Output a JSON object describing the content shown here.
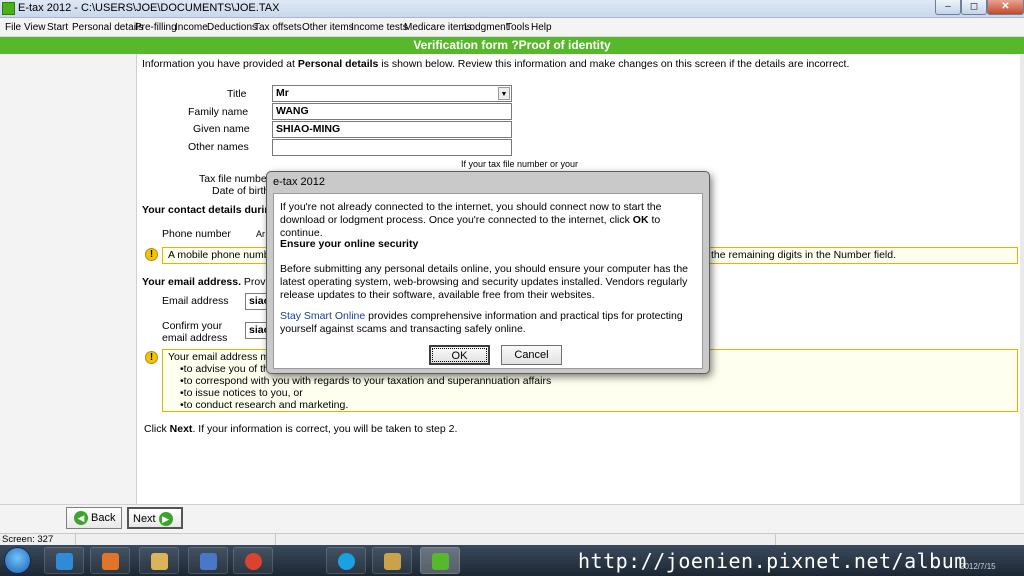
{
  "window": {
    "title": "E-tax 2012 - C:\\USERS\\JOE\\DOCUMENTS\\JOE.TAX",
    "min_glyph": "–",
    "max_glyph": "◻",
    "close_glyph": "✕"
  },
  "menu": [
    "File",
    "View",
    "Start",
    "Personal details",
    "Pre-filling",
    "Income",
    "Deductions",
    "Tax offsets",
    "Other items",
    "Income tests",
    "Medicare items",
    "Lodgment",
    "Tools",
    "Help"
  ],
  "form": {
    "header": "Verification form ?Proof of identity",
    "intro_prefix": "Information you have provided at ",
    "intro_bold": "Personal details",
    "intro_suffix": " is shown below. Review this information and make changes on this screen if the details are incorrect.",
    "title_label": "Title",
    "title_value": "Mr",
    "family_label": "Family name",
    "family_value": "WANG",
    "given_label": "Given name",
    "given_value": "SHIAO-MING",
    "other_label": "Other names",
    "other_value": "",
    "tfn_label": "Tax file number",
    "dob_label": "Date of birth",
    "tfn_note": "If your tax file number or your",
    "contact_heading": "Your contact details during",
    "phone_label": "Phone number",
    "phone_partial": "Ar",
    "mobile_note_start": "A mobile phone numbe",
    "mobile_note_end": "the remaining digits in the Number field.",
    "email_heading_bold": "Your email address.",
    "email_heading_rest": " Providi",
    "email_label": "Email address",
    "email_value": "siao",
    "confirm_label_1": "Confirm your",
    "confirm_label_2": "email address",
    "confirm_value": "siao",
    "email_note_start": "Your email address ma",
    "email_uses": [
      "•to advise you of the",
      "•to correspond with you with regards to your taxation and superannuation affairs",
      "•to issue notices to you, or",
      "•to conduct research and marketing."
    ],
    "click_prefix": "Click ",
    "click_bold": "Next",
    "click_suffix": ". If your information is correct, you will be taken to step 2."
  },
  "nav": {
    "back_label": "Back",
    "next_label": "Next"
  },
  "status": {
    "screen": "Screen: 327"
  },
  "dialog": {
    "title": "e-tax 2012",
    "para1_a": "If you're not already connected to the internet, you should connect now to start the download or lodgment process. Once you're connected to the internet, click ",
    "para1_bold": "OK",
    "para1_b": " to continue.",
    "security_heading": "Ensure your online security",
    "para2": "Before submitting any personal details online, you should ensure your computer has the latest operating system, web-browsing and security updates installed. Vendors regularly release updates to their software, available free from their websites.",
    "link_text": "Stay Smart Online",
    "para3": " provides comprehensive information and practical tips for protecting yourself against scams and transacting safely online.",
    "ok_label": "OK",
    "cancel_label": "Cancel"
  },
  "taskbar": {
    "apps": [
      "internet-explorer",
      "media-player",
      "file-explorer",
      "photos",
      "chrome",
      "skype",
      "paint",
      "e-tax"
    ],
    "clock": "2012/7/15"
  },
  "watermark": "http://joenien.pixnet.net/album"
}
